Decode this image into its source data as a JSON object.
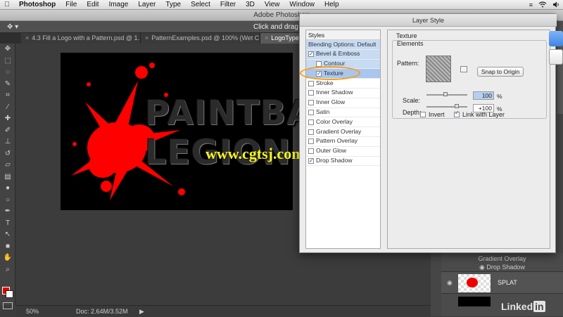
{
  "menubar": {
    "items": [
      "Photoshop",
      "File",
      "Edit",
      "Image",
      "Layer",
      "Type",
      "Select",
      "Filter",
      "3D",
      "View",
      "Window",
      "Help"
    ],
    "right": [
      "≡",
      "wifi",
      "🔊"
    ]
  },
  "window": {
    "title": "Adobe Photoshop"
  },
  "options": {
    "hint": "Click and drag to"
  },
  "tabs": [
    {
      "label": "4.3 Fill a Logo with a Pattern.psd @ 1...",
      "active": false
    },
    {
      "label": "PatternExamples.psd @ 100% (Wet C...",
      "active": false
    },
    {
      "label": "LogoType.psd",
      "active": true
    }
  ],
  "canvas": {
    "line1": "PAINTBA",
    "line2": "LEGION",
    "watermark": "www.cgtsj.com",
    "splat_color": "#ff0000"
  },
  "status": {
    "zoom": "50%",
    "doc": "Doc: 2.64M/3.52M"
  },
  "swatches": {
    "foreground": "#e10000",
    "background": "#ffffff"
  },
  "layers": {
    "effects": [
      "Gradient Overlay",
      "Drop Shadow"
    ],
    "layer_name": "SPLAT"
  },
  "watermark_logo": {
    "text": "Linked",
    "in": "in"
  },
  "dialog": {
    "title": "Layer Style",
    "styles_header": "Styles",
    "items": [
      {
        "label": "Blending Options: Default",
        "check": false,
        "hasbox": false,
        "sub": false,
        "state": "sel"
      },
      {
        "label": "Bevel & Emboss",
        "check": true,
        "hasbox": true,
        "sub": false,
        "state": "sel"
      },
      {
        "label": "Contour",
        "check": false,
        "hasbox": true,
        "sub": true,
        "state": "sel"
      },
      {
        "label": "Texture",
        "check": true,
        "hasbox": true,
        "sub": true,
        "state": "hl"
      },
      {
        "label": "Stroke",
        "check": false,
        "hasbox": true,
        "sub": false,
        "state": ""
      },
      {
        "label": "Inner Shadow",
        "check": false,
        "hasbox": true,
        "sub": false,
        "state": ""
      },
      {
        "label": "Inner Glow",
        "check": false,
        "hasbox": true,
        "sub": false,
        "state": ""
      },
      {
        "label": "Satin",
        "check": false,
        "hasbox": true,
        "sub": false,
        "state": ""
      },
      {
        "label": "Color Overlay",
        "check": false,
        "hasbox": true,
        "sub": false,
        "state": ""
      },
      {
        "label": "Gradient Overlay",
        "check": false,
        "hasbox": true,
        "sub": false,
        "state": ""
      },
      {
        "label": "Pattern Overlay",
        "check": false,
        "hasbox": true,
        "sub": false,
        "state": ""
      },
      {
        "label": "Outer Glow",
        "check": false,
        "hasbox": true,
        "sub": false,
        "state": ""
      },
      {
        "label": "Drop Shadow",
        "check": true,
        "hasbox": true,
        "sub": false,
        "state": ""
      }
    ],
    "texture": {
      "section": "Texture",
      "group": "Elements",
      "pattern_label": "Pattern:",
      "snap_button": "Snap to Origin",
      "scale_label": "Scale:",
      "scale_value": "100",
      "depth_label": "Depth:",
      "depth_value": "+100",
      "unit": "%",
      "invert_label": "Invert",
      "link_label": "Link with Layer"
    }
  }
}
